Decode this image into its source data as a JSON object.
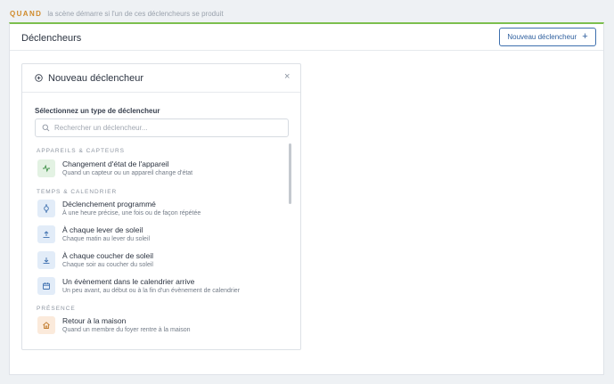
{
  "header": {
    "tag": "QUAND",
    "description": "la scène démarre si l'un de ces déclencheurs se produit"
  },
  "panel": {
    "title": "Déclencheurs",
    "new_button_label": "Nouveau déclencheur",
    "new_button_icon": "+"
  },
  "card": {
    "title": "Nouveau déclencheur",
    "close_icon": "×",
    "select_label": "Sélectionnez un type de déclencheur",
    "search": {
      "placeholder": "Rechercher un déclencheur..."
    },
    "groups": [
      {
        "label": "APPAREILS & CAPTEURS"
      },
      {
        "label": "TEMPS & CALENDRIER"
      },
      {
        "label": "PRÉSENCE"
      }
    ],
    "items": [
      {
        "title": "Changement d'état de l'appareil",
        "subtitle": "Quand un capteur ou un appareil change d'état",
        "icon": "activity-icon",
        "color": "#e3f2e3"
      },
      {
        "title": "Déclenchement programmé",
        "subtitle": "À une heure précise, une fois ou de façon répétée",
        "icon": "watch-icon",
        "color": "#e2ecf8"
      },
      {
        "title": "À chaque lever de soleil",
        "subtitle": "Chaque matin au lever du soleil",
        "icon": "sunrise-icon",
        "color": "#e2ecf8"
      },
      {
        "title": "À chaque coucher de soleil",
        "subtitle": "Chaque soir au coucher du soleil",
        "icon": "sunset-icon",
        "color": "#e2ecf8"
      },
      {
        "title": "Un évènement dans le calendrier arrive",
        "subtitle": "Un peu avant, au début ou à la fin d'un évènement de calendrier",
        "icon": "calendar-icon",
        "color": "#e2ecf8"
      },
      {
        "title": "Retour à la maison",
        "subtitle": "Quand un membre du foyer rentre à la maison",
        "icon": "home-icon",
        "color": "#fbeadb"
      }
    ]
  },
  "colors": {
    "accent_green": "#7cbf4e",
    "tag_orange": "#d08a2a",
    "button_blue": "#2e5f9e"
  }
}
